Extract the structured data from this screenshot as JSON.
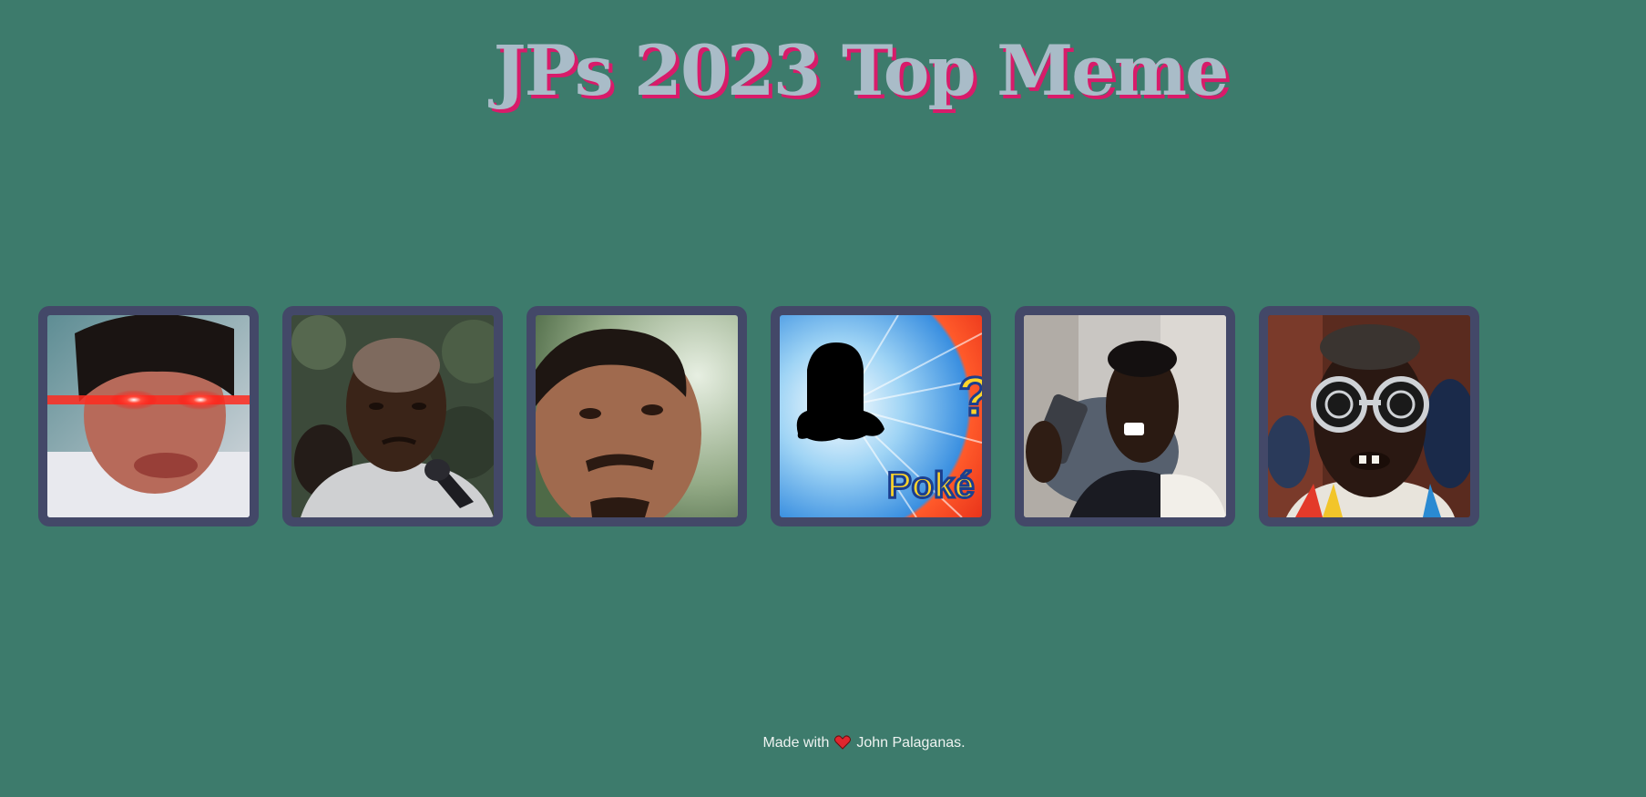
{
  "title": "JPs 2023 Top Meme",
  "colors": {
    "background": "#3d7b6c",
    "title_text": "#a9bcc8",
    "title_shadow": "#d81b6a",
    "card_frame": "#434868",
    "heart": "#e0262e"
  },
  "memes": [
    {
      "icon": "laser-eyes-meme-image"
    },
    {
      "icon": "interviewed-man-meme-image"
    },
    {
      "icon": "close-up-face-meme-image"
    },
    {
      "icon": "whos-that-pokemon-meme-image"
    },
    {
      "icon": "phone-call-meme-image"
    },
    {
      "icon": "swirl-glasses-meme-image"
    }
  ],
  "footer": {
    "prefix": "Made with",
    "icon": "heart-icon",
    "author": "John Palaganas."
  }
}
